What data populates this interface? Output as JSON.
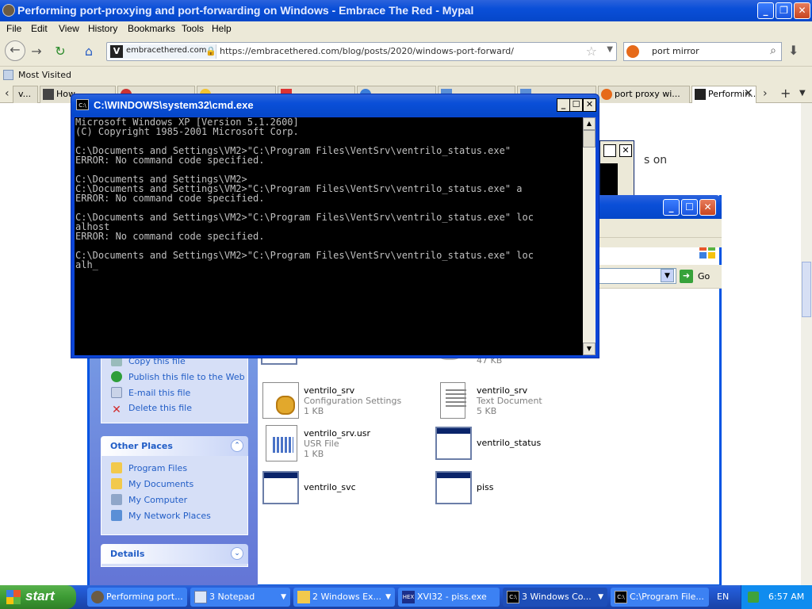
{
  "firefox": {
    "title": "Performing port-proxying and port-forwarding on Windows - Embrace The Red - Mypal",
    "menu": [
      "File",
      "Edit",
      "View",
      "History",
      "Bookmarks",
      "Tools",
      "Help"
    ],
    "site_identity": "embracethered.com",
    "url": "https://embracethered.com/blog/posts/2020/windows-port-forward/",
    "search_query": "port mirror",
    "bookmarks_label": "Most Visited",
    "tabs": [
      {
        "label": "v...",
        "color": "#dddddd"
      },
      {
        "label": "How",
        "color": "#444444"
      },
      {
        "label": "",
        "color": "#c33"
      },
      {
        "label": "",
        "color": "#f4c430"
      },
      {
        "label": "",
        "color": "#d33"
      },
      {
        "label": "",
        "color": "#3b7dd8"
      },
      {
        "label": "",
        "color": "#5b8fd6"
      },
      {
        "label": "",
        "color": "#5b8fd6"
      },
      {
        "label": "port proxy wi...",
        "color": "#e66a1a"
      },
      {
        "label": "Performin...",
        "color": "#222222"
      }
    ],
    "page_peek_text": "s on"
  },
  "cmd": {
    "title": "C:\\WINDOWS\\system32\\cmd.exe",
    "lines": [
      "Microsoft Windows XP [Version 5.1.2600]",
      "(C) Copyright 1985-2001 Microsoft Corp.",
      "",
      "C:\\Documents and Settings\\VM2>\"C:\\Program Files\\VentSrv\\ventrilo_status.exe\"",
      "ERROR: No command code specified.",
      "",
      "C:\\Documents and Settings\\VM2>",
      "C:\\Documents and Settings\\VM2>\"C:\\Program Files\\VentSrv\\ventrilo_status.exe\" a",
      "ERROR: No command code specified.",
      "",
      "C:\\Documents and Settings\\VM2>\"C:\\Program Files\\VentSrv\\ventrilo_status.exe\" loc",
      "alhost",
      "ERROR: No command code specified.",
      "",
      "C:\\Documents and Settings\\VM2>\"C:\\Program Files\\VentSrv\\ventrilo_status.exe\" loc",
      "alh_"
    ]
  },
  "explorer": {
    "go_label": "Go",
    "file_tasks": [
      {
        "label": "Copy this file",
        "color": "#8aa"
      },
      {
        "label": "Publish this file to the Web",
        "color": "#2e9e3a"
      },
      {
        "label": "E-mail this file",
        "color": "#7f92b8"
      },
      {
        "label": "Delete this file",
        "color": "#d12a2a"
      }
    ],
    "other_places_title": "Other Places",
    "other_places": [
      {
        "label": "Program Files",
        "color": "#f2c94c"
      },
      {
        "label": "My Documents",
        "color": "#f2c94c"
      },
      {
        "label": "My Computer",
        "color": "#8fa6c9"
      },
      {
        "label": "My Network Places",
        "color": "#5a8fd6"
      }
    ],
    "details_title": "Details",
    "files": [
      {
        "name": "",
        "type": "",
        "size": ""
      },
      {
        "name": "",
        "type": "",
        "size": "47 KB"
      },
      {
        "name": "ventrilo_srv",
        "type": "Configuration Settings",
        "size": "1 KB"
      },
      {
        "name": "ventrilo_srv",
        "type": "Text Document",
        "size": "5 KB"
      },
      {
        "name": "ventrilo_srv.usr",
        "type": "USR File",
        "size": "1 KB"
      },
      {
        "name": "ventrilo_status",
        "type": "",
        "size": ""
      },
      {
        "name": "ventrilo_svc",
        "type": "",
        "size": ""
      },
      {
        "name": "piss",
        "type": "",
        "size": ""
      }
    ]
  },
  "taskbar": {
    "start_label": "start",
    "buttons": [
      {
        "label": "Performing port...",
        "arrow": false
      },
      {
        "label": "3 Notepad",
        "arrow": true
      },
      {
        "label": "2 Windows Ex...",
        "arrow": true
      },
      {
        "label": "XVI32 - piss.exe",
        "arrow": false
      },
      {
        "label": "3 Windows Co...",
        "arrow": true
      },
      {
        "label": "C:\\Program File...",
        "arrow": false
      }
    ],
    "language": "EN",
    "clock": "6:57 AM"
  }
}
